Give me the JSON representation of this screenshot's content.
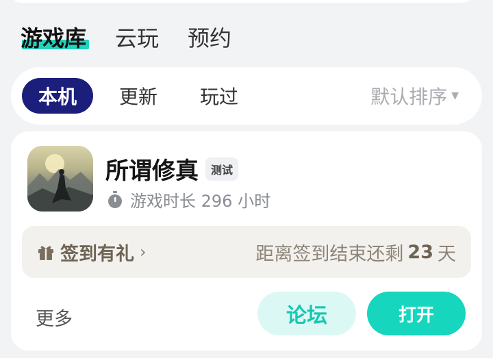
{
  "header": {
    "tabs": [
      {
        "label": "游戏库",
        "active": true
      },
      {
        "label": "云玩",
        "active": false
      },
      {
        "label": "预约",
        "active": false
      }
    ]
  },
  "filter": {
    "chips": [
      {
        "label": "本机",
        "active": true
      },
      {
        "label": "更新",
        "active": false
      },
      {
        "label": "玩过",
        "active": false
      }
    ],
    "sort_label": "默认排序",
    "sort_icon": "caret-down-icon"
  },
  "game": {
    "title": "所谓修真",
    "badge": "测试",
    "playtime": "游戏时长 296 小时",
    "playtime_icon": "stopwatch-icon",
    "signin": {
      "label": "签到有礼",
      "icon": "gift-icon",
      "countdown_prefix": "距离签到结束还剩",
      "countdown_days": "23",
      "countdown_suffix": "天"
    },
    "more_label": "更多",
    "forum_label": "论坛",
    "open_label": "打开"
  },
  "colors": {
    "accent": "#16d6bd",
    "active_chip": "#1b1e7a",
    "forum_bg": "#dcf8f5",
    "signin_bg": "#f3f1ee"
  }
}
